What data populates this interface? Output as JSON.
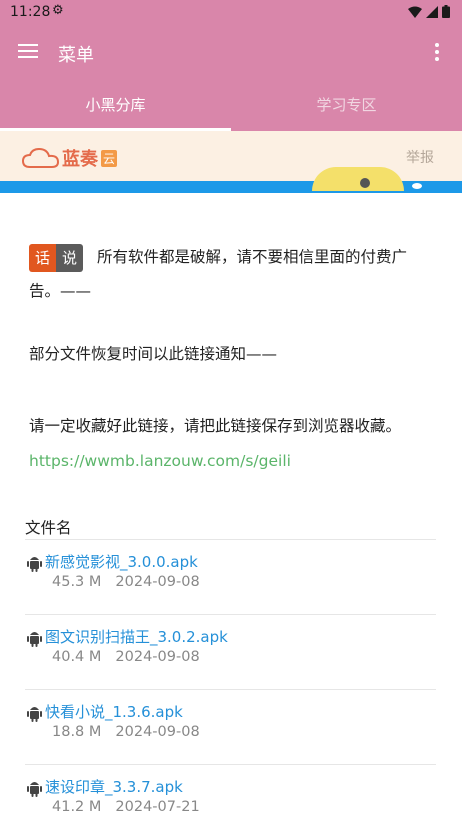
{
  "status_bar": {
    "time": "11:28"
  },
  "app_bar": {
    "title": "菜单"
  },
  "tabs": [
    {
      "label": "小黑分库",
      "active": true
    },
    {
      "label": "学习专区",
      "active": false
    }
  ],
  "banner": {
    "brand": "蓝奏",
    "brand_badge": "云",
    "report": "举报"
  },
  "notice": {
    "badge_left": "话",
    "badge_right": "说",
    "text1": "所有软件都是破解，请不要相信里面的付费广告。——",
    "text2": "部分文件恢复时间以此链接通知——",
    "text3": "请一定收藏好此链接，请把此链接保存到浏览器收藏。",
    "link": "https://wwmb.lanzouw.com/s/geili"
  },
  "file_list": {
    "header": "文件名",
    "items": [
      {
        "name": "新感觉影视_3.0.0.apk",
        "size": "45.3 M",
        "date": "2024-09-08"
      },
      {
        "name": "图文识别扫描王_3.0.2.apk",
        "size": "40.4 M",
        "date": "2024-09-08"
      },
      {
        "name": "快看小说_1.3.6.apk",
        "size": "18.8 M",
        "date": "2024-09-08"
      },
      {
        "name": "速设印章_3.3.7.apk",
        "size": "41.2 M",
        "date": "2024-07-21"
      }
    ]
  },
  "colors": {
    "accent": "#d986aa",
    "link": "#5bb56a",
    "file_link": "#2590d8"
  }
}
